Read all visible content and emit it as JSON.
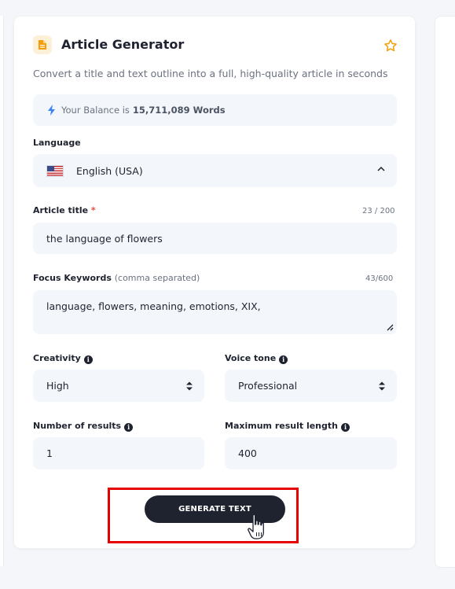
{
  "header": {
    "title": "Article Generator",
    "description": "Convert a title and text outline into a full, high-quality article in seconds"
  },
  "balance": {
    "prefix": "Your Balance is",
    "amount": "15,711,089 Words"
  },
  "language": {
    "label": "Language",
    "value": "English (USA)"
  },
  "article_title": {
    "label": "Article title",
    "required_mark": "*",
    "counter": "23 / 200",
    "value": "the language of flowers"
  },
  "keywords": {
    "label": "Focus Keywords",
    "hint": "(comma separated)",
    "counter": "43/600",
    "value": "language, flowers, meaning, emotions, XIX,"
  },
  "creativity": {
    "label": "Creativity",
    "value": "High"
  },
  "voice_tone": {
    "label": "Voice tone",
    "value": "Professional"
  },
  "num_results": {
    "label": "Number of results",
    "value": "1"
  },
  "max_length": {
    "label": "Maximum result length",
    "value": "400"
  },
  "actions": {
    "generate_label": "GENERATE TEXT"
  },
  "colors": {
    "accent_orange": "#f59e0b",
    "bolt_blue": "#3b82f6",
    "button_dark": "#1f2330",
    "highlight_red": "#e60000",
    "field_bg": "#f3f6fa"
  },
  "icons": {
    "doc": "document-icon",
    "star": "star-icon",
    "bolt": "lightning-icon",
    "info": "info-icon",
    "chevron": "chevron-up-icon",
    "updown": "select-arrows-icon",
    "cursor": "hand-pointer-icon"
  }
}
